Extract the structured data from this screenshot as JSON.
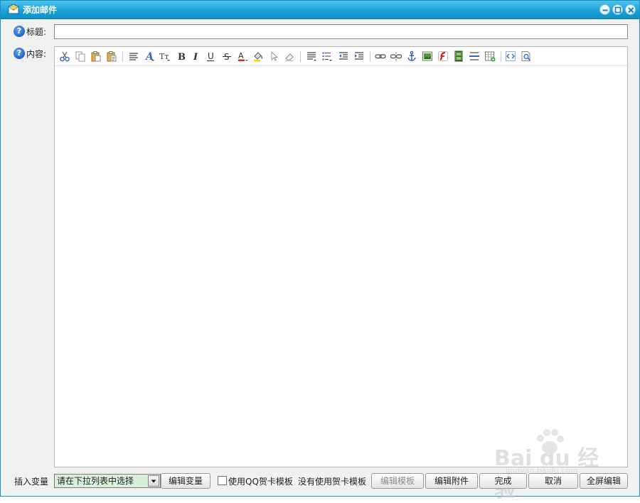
{
  "window": {
    "title": "添加邮件"
  },
  "form": {
    "subject_label": "标题:",
    "subject_value": "",
    "content_label": "内容:",
    "help_glyph": "?"
  },
  "toolbar": {
    "items": [
      "cut-icon",
      "copy-icon",
      "paste-icon",
      "paste-text-icon",
      "font-family-icon",
      "font-style-icon",
      "font-size-icon",
      "bold-icon",
      "italic-icon",
      "underline-icon",
      "strikethrough-icon",
      "font-color-icon",
      "background-color-icon",
      "select-icon",
      "eraser-icon",
      "align-icon",
      "list-icon",
      "outdent-icon",
      "indent-icon",
      "link-icon",
      "unlink-icon",
      "anchor-icon",
      "image-icon",
      "flash-icon",
      "media-icon",
      "horizontal-rule-icon",
      "table-icon",
      "source-icon",
      "preview-icon"
    ],
    "bold_glyph": "B",
    "italic_glyph": "I",
    "underline_glyph": "U",
    "strike_glyph": "S",
    "font_color_glyph": "A",
    "font_size_glyph": "Tт"
  },
  "bottom": {
    "insert_var_label": "插入变量",
    "var_select_value": "请在下拉列表中选择",
    "edit_var_button": "编辑变量",
    "use_qq_card_label": "使用QQ贺卡模板",
    "use_qq_card_checked": false,
    "no_template_text": "没有使用贺卡模板",
    "edit_template_button": "编辑模板",
    "edit_attachment_button": "编辑附件",
    "done_button": "完成",
    "cancel_button": "取消",
    "fullscreen_button": "全屏编辑"
  },
  "watermark": {
    "text": "Bai du 经验",
    "sub": "jingyan.baidu.com"
  },
  "colors": {
    "titlebar": "#1aa3d9",
    "select_bg": "#d8f0d8",
    "help_icon": "#1d5fc4"
  }
}
